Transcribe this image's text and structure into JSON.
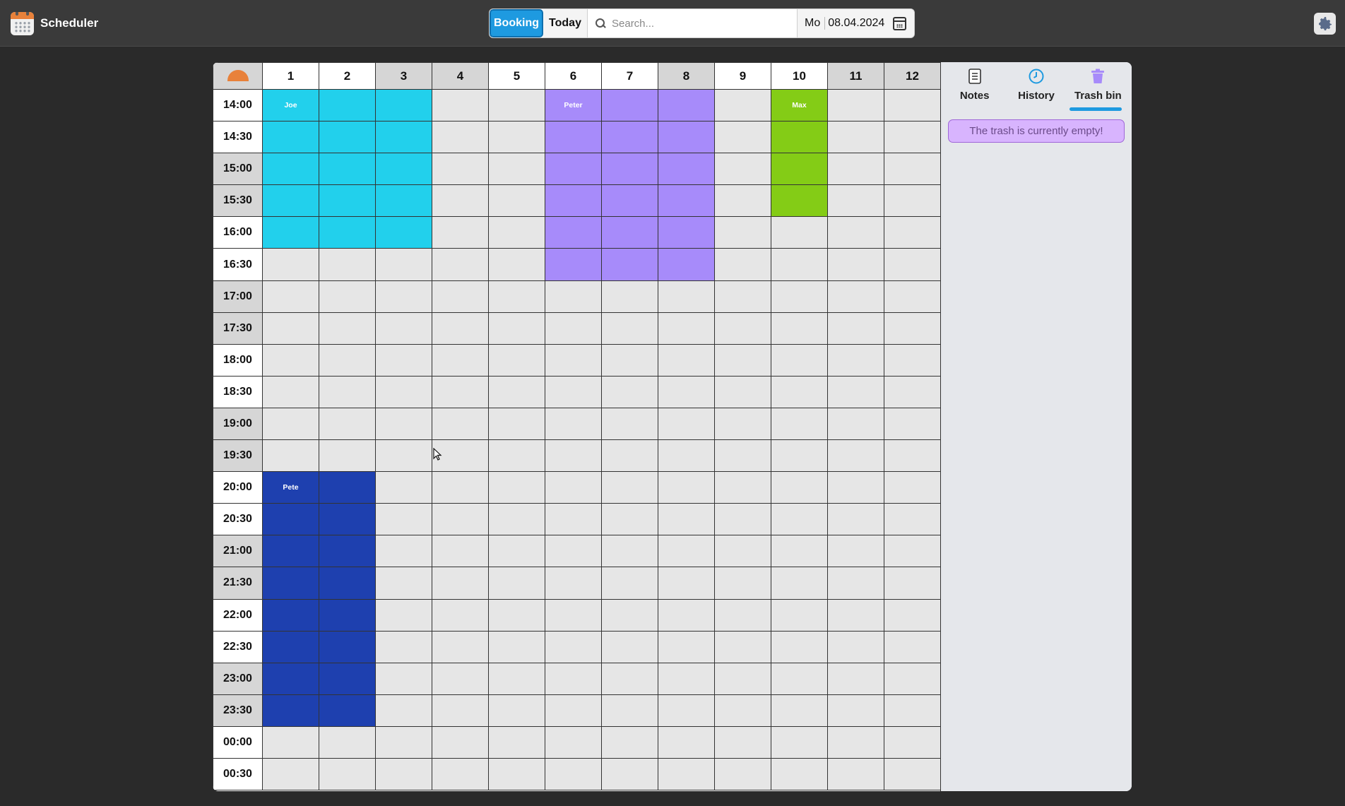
{
  "app": {
    "title": "Scheduler"
  },
  "toolbar": {
    "booking_label": "Booking",
    "today_label": "Today",
    "search_placeholder": "Search...",
    "date_day": "Mo",
    "date_value": "08.04.2024"
  },
  "grid": {
    "columns": [
      "1",
      "2",
      "3",
      "4",
      "5",
      "6",
      "7",
      "8",
      "9",
      "10",
      "11",
      "12"
    ],
    "times": [
      "14:00",
      "14:30",
      "15:00",
      "15:30",
      "16:00",
      "16:30",
      "17:00",
      "17:30",
      "18:00",
      "18:30",
      "19:00",
      "19:30",
      "20:00",
      "20:30",
      "21:00",
      "21:30",
      "22:00",
      "22:30",
      "23:00",
      "23:30",
      "00:00",
      "00:30"
    ],
    "bookings": [
      {
        "name": "Joe",
        "color": "#22d0ec",
        "columns": [
          "1",
          "2",
          "3"
        ],
        "start": "14:00",
        "end": "16:30"
      },
      {
        "name": "Peter",
        "color": "#a78bfa",
        "columns": [
          "6",
          "7",
          "8"
        ],
        "start": "14:00",
        "end": "17:00"
      },
      {
        "name": "Max",
        "color": "#84cc16",
        "columns": [
          "10"
        ],
        "start": "14:00",
        "end": "16:00"
      },
      {
        "name": "Pete",
        "color": "#1e40af",
        "columns": [
          "1",
          "2"
        ],
        "start": "20:00",
        "end": "00:00"
      }
    ]
  },
  "side_panel": {
    "tabs": [
      {
        "label": "Notes",
        "icon": "notes-icon"
      },
      {
        "label": "History",
        "icon": "clock-icon"
      },
      {
        "label": "Trash bin",
        "icon": "trash-icon",
        "active": true
      }
    ],
    "trash_message": "The trash is currently empty!"
  }
}
